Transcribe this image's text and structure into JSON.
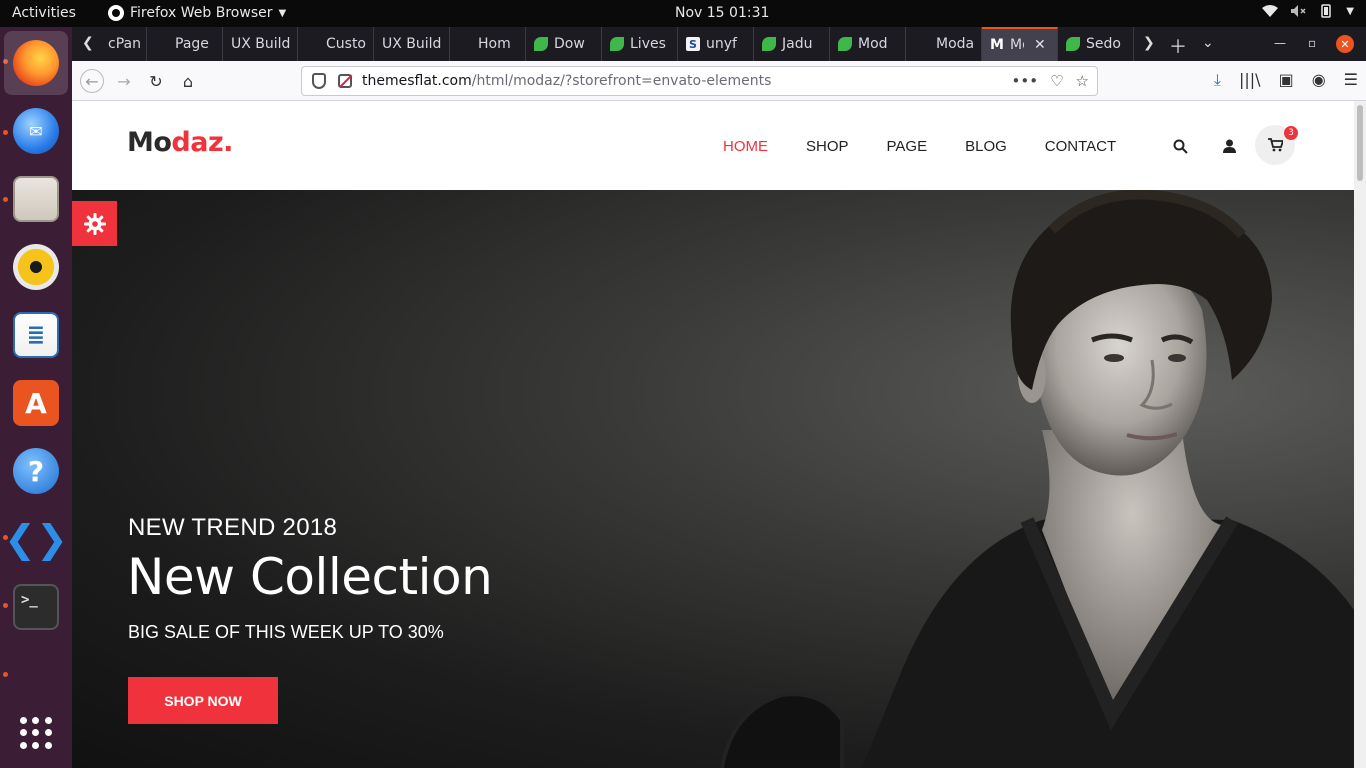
{
  "topbar": {
    "activities": "Activities",
    "app_name": "Firefox Web Browser",
    "clock": "Nov 15  01:31"
  },
  "dock": {
    "apps": [
      "Firefox",
      "Thunderbird",
      "Files",
      "Rhythmbox",
      "LibreOffice Writer",
      "Ubuntu Software",
      "Help",
      "Visual Studio Code",
      "Terminal"
    ]
  },
  "browser": {
    "tabs": [
      {
        "title": "cPan",
        "icon": "page"
      },
      {
        "title": "Page",
        "icon": "page"
      },
      {
        "title": "UX Build",
        "icon": "none"
      },
      {
        "title": "Custo",
        "icon": "page"
      },
      {
        "title": "UX Build",
        "icon": "none"
      },
      {
        "title": "Hom",
        "icon": "page"
      },
      {
        "title": "Dow",
        "icon": "leaf"
      },
      {
        "title": "Lives",
        "icon": "leaf"
      },
      {
        "title": "unyf",
        "icon": "s"
      },
      {
        "title": "Jadu",
        "icon": "leaf"
      },
      {
        "title": "Mod",
        "icon": "leaf"
      },
      {
        "title": "Moda",
        "icon": "none"
      },
      {
        "title": "Mo",
        "icon": "m",
        "active": true
      },
      {
        "title": "Sedo",
        "icon": "leaf"
      }
    ],
    "url_domain": "themesflat.com",
    "url_path": "/html/modaz/?storefront=envato-elements"
  },
  "site": {
    "logo_main": "Mo",
    "logo_accent": "daz.",
    "nav": [
      "HOME",
      "SHOP",
      "PAGE",
      "BLOG",
      "CONTACT"
    ],
    "cart_count": "3",
    "accent_color": "#f0323c"
  },
  "hero": {
    "kicker": "NEW TREND 2018",
    "headline": "New Collection",
    "subline": "BIG SALE OF THIS WEEK UP TO 30%",
    "cta": "SHOP NOW"
  }
}
